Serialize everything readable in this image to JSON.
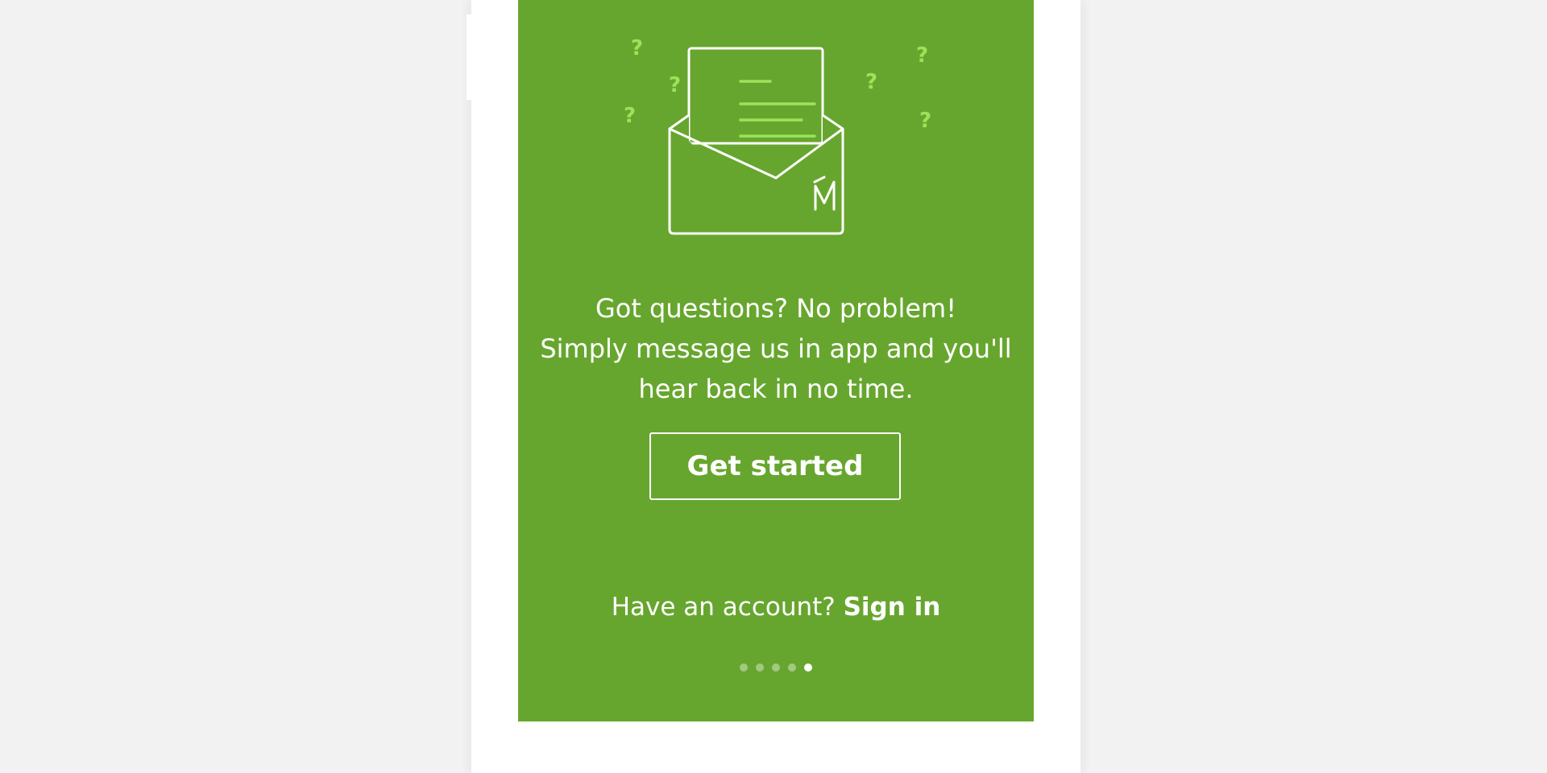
{
  "onboarding": {
    "message_lines": [
      "Got questions? No problem!",
      "Simply message us in app and you'll",
      "hear back in no time."
    ],
    "cta_label": "Get started",
    "signin_prompt": "Have an account? ",
    "signin_link": "Sign in",
    "pager": {
      "total": 5,
      "active_index": 4
    },
    "illustration": {
      "icon": "envelope-with-letter-icon",
      "decorations": "question-mark-icons",
      "mark": "M"
    }
  },
  "colors": {
    "page_background": "#f2f2f2",
    "device_frame": "#ffffff",
    "screen_green": "#67a62e",
    "accent_light_green": "#9de35a",
    "text": "#ffffff"
  }
}
